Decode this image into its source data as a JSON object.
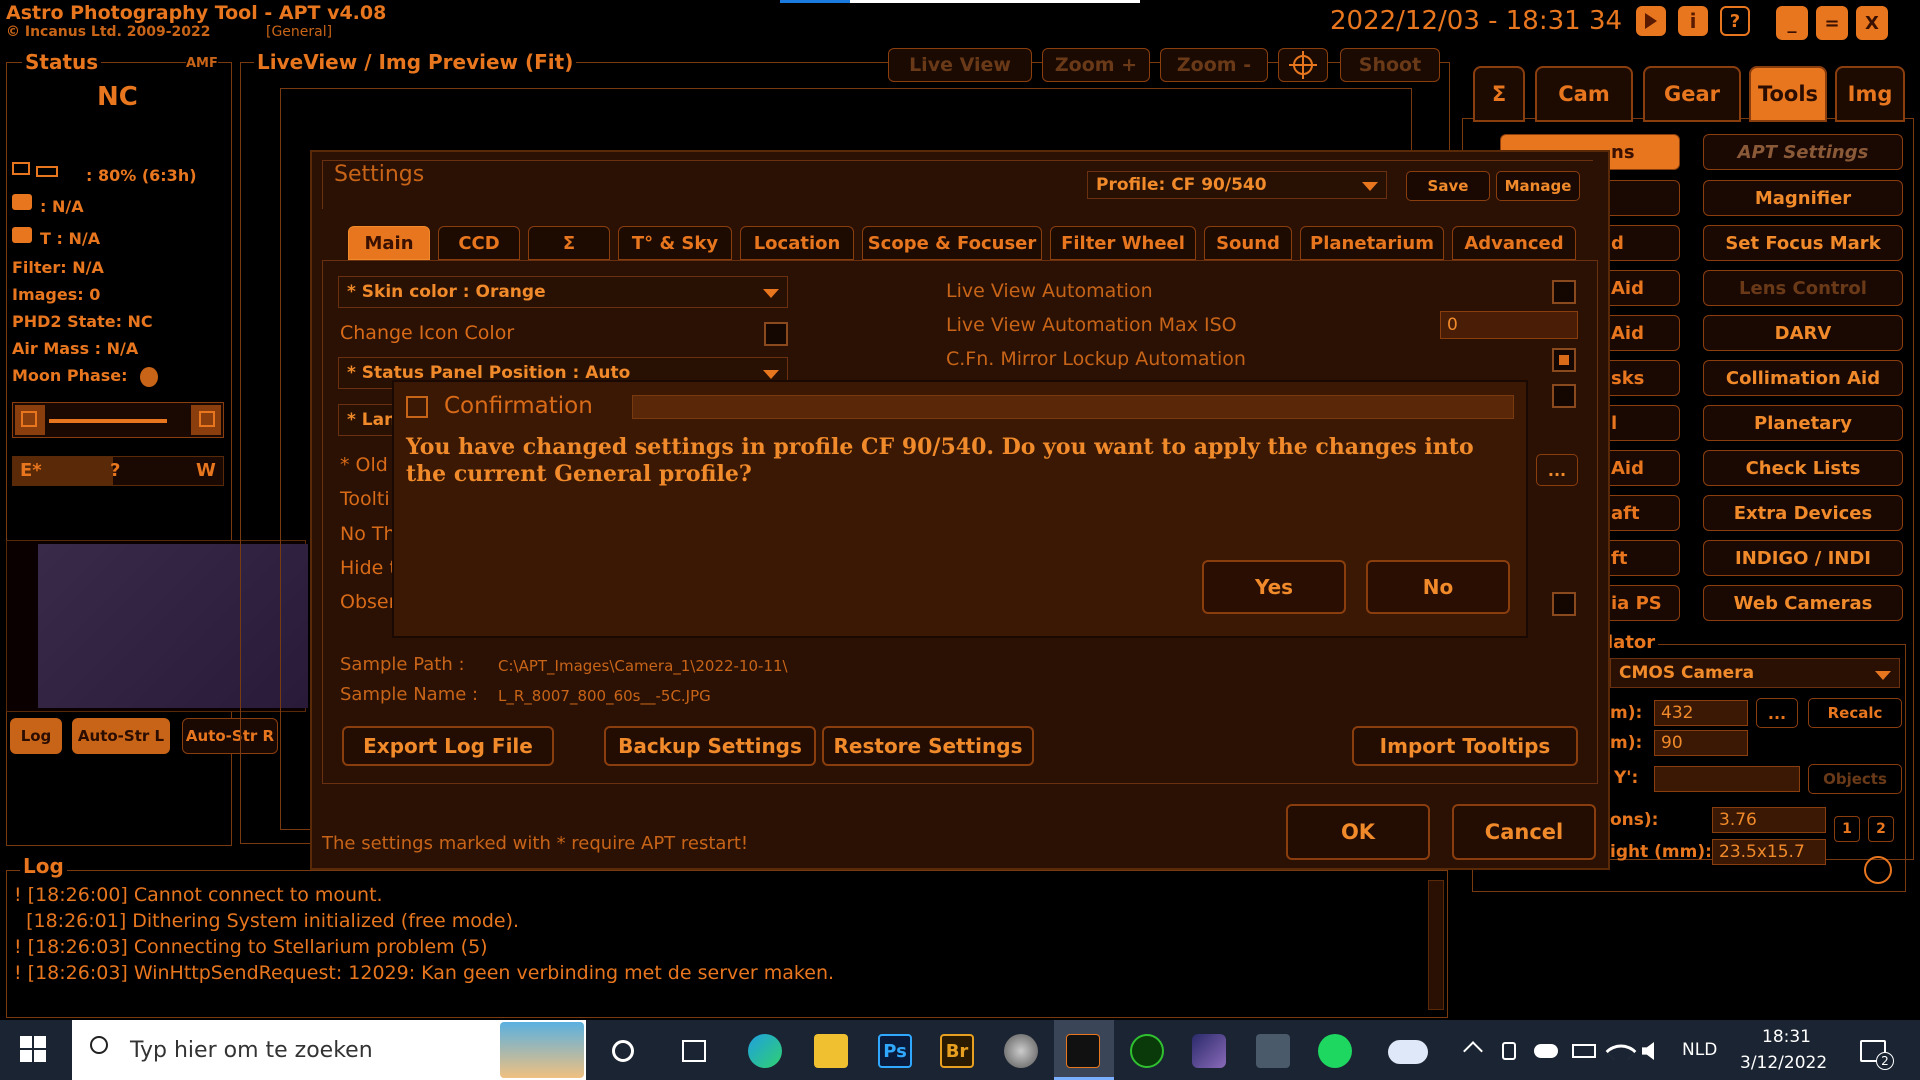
{
  "app": {
    "title": "Astro Photography Tool  -  APT v4.08",
    "copyright": "© Incanus Ltd. 2009-2022",
    "profile_tag": "[General]",
    "datetime": "2022/12/03 - 18:31 34",
    "win_buttons": [
      "_",
      "=",
      "X"
    ]
  },
  "status": {
    "title": "Status",
    "amf": "AMF",
    "nc": "NC",
    "battery": ": 80% (6:3h)",
    "temp1": ": N/A",
    "temp2": "T : N/A",
    "filter": "Filter: N/A",
    "images": "Images: 0",
    "phd2": "PHD2 State: NC",
    "airmass": "Air Mass : N/A",
    "moon": "Moon Phase:",
    "compass_e": "E*",
    "compass_q": "?",
    "compass_w": "W"
  },
  "liveview": {
    "title": "LiveView / Img Preview (Fit)",
    "buttons": [
      "Live View",
      "Zoom +",
      "Zoom -",
      "Shoot"
    ]
  },
  "bottom_buttons": [
    "Log",
    "Auto-Str L",
    "Auto-Str R"
  ],
  "right_tabs": [
    "Σ",
    "Cam",
    "Gear",
    "Tools",
    "Img"
  ],
  "left_tools": [
    "ns",
    "",
    "d",
    "Aid",
    "Aid",
    "sks",
    "l",
    "Aid",
    "aft",
    "ft",
    "ia PS"
  ],
  "tools": [
    "APT Settings",
    "Magnifier",
    "Set Focus Mark",
    "Lens Control",
    "DARV",
    "Collimation Aid",
    "Planetary",
    "Check Lists",
    "Extra Devices",
    "INDIGO / INDI",
    "Web Cameras"
  ],
  "calculator": {
    "title": "lator",
    "camera": "CMOS Camera",
    "row1_label": "m):",
    "row1_value": "432",
    "row1_more": "...",
    "recalc": "Recalc",
    "row2_label": "m):",
    "row2_value": "90",
    "row3_label": "Y':",
    "objects": "Objects",
    "row4_label": "ons):",
    "row4_value": "3.76",
    "row5_label": "ight (mm):",
    "row5_value": "23.5x15.7",
    "num1": "1",
    "num2": "2"
  },
  "settings": {
    "title": "Settings",
    "profile": "Profile: CF 90/540",
    "save": "Save",
    "manage": "Manage",
    "tabs": [
      "Main",
      "CCD",
      "Σ",
      "T° & Sky",
      "Location",
      "Scope & Focuser",
      "Filter Wheel",
      "Sound",
      "Planetarium",
      "Advanced"
    ],
    "skin_color": "* Skin color : Orange",
    "change_icon_color": "Change Icon Color",
    "status_panel": "* Status Panel Position : Auto",
    "lang": "* Lan",
    "old": "* Old",
    "tooltip": "Toolti",
    "no_th": "No Th",
    "hide": "Hide t",
    "obser": "Obser",
    "lv_auto": "Live View Automation",
    "lv_auto_iso": "Live View Automation Max ISO",
    "lv_auto_iso_value": "0",
    "mirror_lockup": "C.Fn. Mirror Lockup Automation",
    "more": "...",
    "sample_path_label": "Sample Path :",
    "sample_path": "C:\\APT_Images\\Camera_1\\2022-10-11\\",
    "sample_name_label": "Sample Name :",
    "sample_name": "L_R_8007_800_60s__-5C.JPG",
    "export_log": "Export Log File",
    "backup": "Backup Settings",
    "restore": "Restore Settings",
    "import_tooltips": "Import Tooltips",
    "ok": "OK",
    "cancel": "Cancel",
    "restart_note": "The settings marked with * require APT restart!"
  },
  "confirm": {
    "title": "Confirmation",
    "message": "You have changed settings in profile CF 90/540. Do you want to apply the changes into the current General profile?",
    "yes": "Yes",
    "no": "No"
  },
  "log": {
    "title": "Log",
    "lines": [
      "! [18:26:00] Cannot connect to mount.",
      "  [18:26:01] Dithering System initialized (free mode).",
      "! [18:26:03] Connecting to Stellarium problem (5)",
      "! [18:26:03] WinHttpSendRequest: 12029: Kan geen verbinding met de server maken."
    ]
  },
  "taskbar": {
    "search_placeholder": "Typ hier om te zoeken",
    "lang": "NLD",
    "time": "18:31",
    "date": "3/12/2022",
    "notif_count": "2"
  },
  "colors": {
    "accent": "#e8761e",
    "bg": "#000000",
    "panel": "#1d0b02",
    "dialog_bg": "#3a1804",
    "taskbar": "#1b2432"
  }
}
